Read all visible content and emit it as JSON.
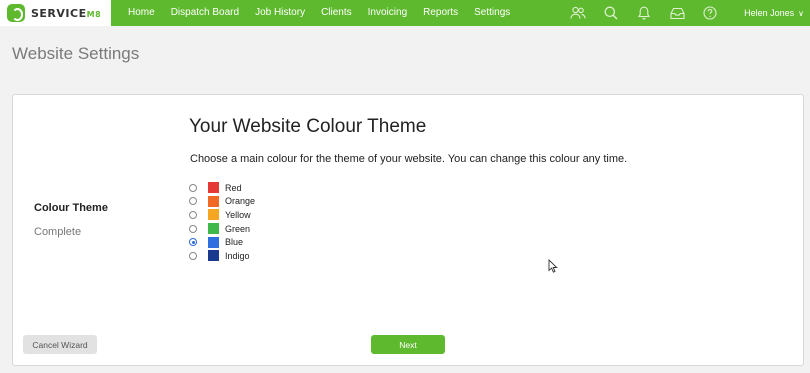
{
  "header": {
    "brand": "SERVICE",
    "brand_suffix": "M8",
    "nav": [
      "Home",
      "Dispatch Board",
      "Job History",
      "Clients",
      "Invoicing",
      "Reports",
      "Settings"
    ],
    "icons": [
      "people-icon",
      "search-icon",
      "bell-icon",
      "inbox-icon",
      "help-icon"
    ],
    "user_name": "Helen Jones",
    "accent_color": "#5fb92e"
  },
  "page": {
    "title": "Website Settings"
  },
  "wizard": {
    "step_title": "Colour Theme",
    "step_status": "Complete",
    "heading": "Your Website Colour Theme",
    "description": "Choose a main colour for the theme of your website. You can change this colour any time.",
    "selected": "Blue",
    "options": [
      {
        "label": "Red",
        "color": "#e53935"
      },
      {
        "label": "Orange",
        "color": "#f06a25"
      },
      {
        "label": "Yellow",
        "color": "#f5a623"
      },
      {
        "label": "Green",
        "color": "#3fba4a"
      },
      {
        "label": "Blue",
        "color": "#2f6fe0"
      },
      {
        "label": "Indigo",
        "color": "#1a3a8f"
      }
    ],
    "cancel_label": "Cancel Wizard",
    "next_label": "Next"
  }
}
